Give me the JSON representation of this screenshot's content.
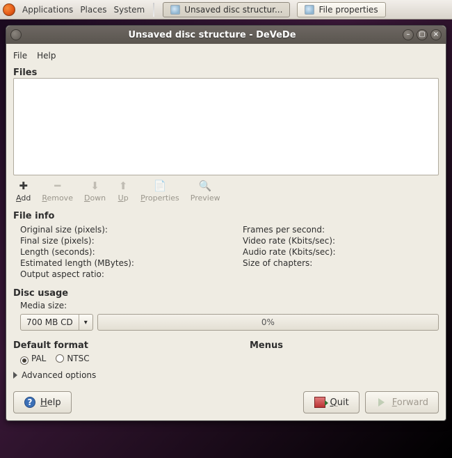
{
  "panel": {
    "applications": "Applications",
    "places": "Places",
    "system": "System",
    "task1": "Unsaved disc structur...",
    "task2": "File properties"
  },
  "window": {
    "title": "Unsaved disc structure - DeVeDe",
    "menu": {
      "file": "ile",
      "file_pre": "F",
      "help": "elp",
      "help_pre": "H"
    },
    "files_label": "Files",
    "toolbar": {
      "add_pre": "A",
      "add": "dd",
      "remove_pre": "R",
      "remove": "emove",
      "down_pre": "D",
      "down": "own",
      "up_pre": "U",
      "up": "p",
      "properties_pre": "P",
      "properties": "roperties",
      "preview": "Preview"
    },
    "fileinfo": {
      "header": "File info",
      "original_size": "Original size (pixels):",
      "final_size": "Final size (pixels):",
      "length": "Length (seconds):",
      "est_length": "Estimated length (MBytes):",
      "aspect": "Output aspect ratio:",
      "fps": "Frames per second:",
      "vrate": "Video rate (Kbits/sec):",
      "arate": "Audio rate (Kbits/sec):",
      "chapters": "Size of chapters:"
    },
    "disc": {
      "header": "Disc usage",
      "media_size_label": "Media size:",
      "media_size_value": "700 MB CD",
      "progress_text": "0%"
    },
    "format": {
      "header": "Default format",
      "pal": "PAL",
      "ntsc": "NTSC"
    },
    "menus_header": "Menus",
    "advanced": "Advanced options",
    "buttons": {
      "help_pre": "H",
      "help": "elp",
      "quit_pre": "Q",
      "quit": "uit",
      "forward_pre": "F",
      "forward": "orward"
    }
  }
}
